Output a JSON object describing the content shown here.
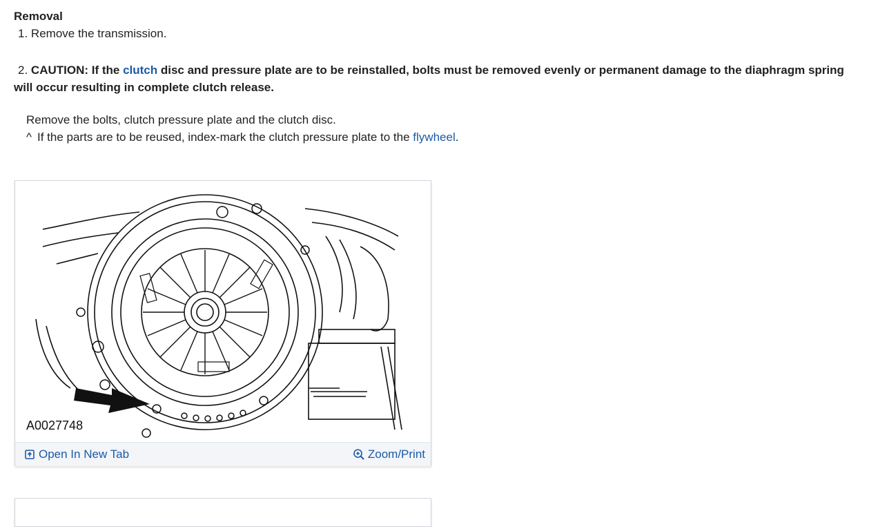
{
  "section": {
    "heading": "Removal"
  },
  "steps": {
    "step1": {
      "number": "1.",
      "text": "Remove the transmission."
    },
    "step2": {
      "number": "2.",
      "caution_prefix": "CAUTION: If the ",
      "caution_link": "clutch",
      "caution_suffix": " disc and pressure plate are to be reinstalled, bolts must be removed evenly or permanent damage to the diaphragm spring will occur resulting in complete clutch release.",
      "instruction": "Remove the bolts, clutch pressure plate and the clutch disc.",
      "note_marker": "^",
      "note_prefix": "If the parts are to be reused, index-mark the clutch pressure plate to the ",
      "note_link": "flywheel",
      "note_suffix": "."
    }
  },
  "figure": {
    "code": "A0027748",
    "open_tab_label": "Open In New Tab",
    "zoom_label": "Zoom/Print",
    "icons": {
      "open_tab": "open-new-tab-icon",
      "zoom": "zoom-in-icon"
    }
  },
  "colors": {
    "link": "#1a5aa6",
    "text": "#222222",
    "bar": "#f3f5f8"
  }
}
